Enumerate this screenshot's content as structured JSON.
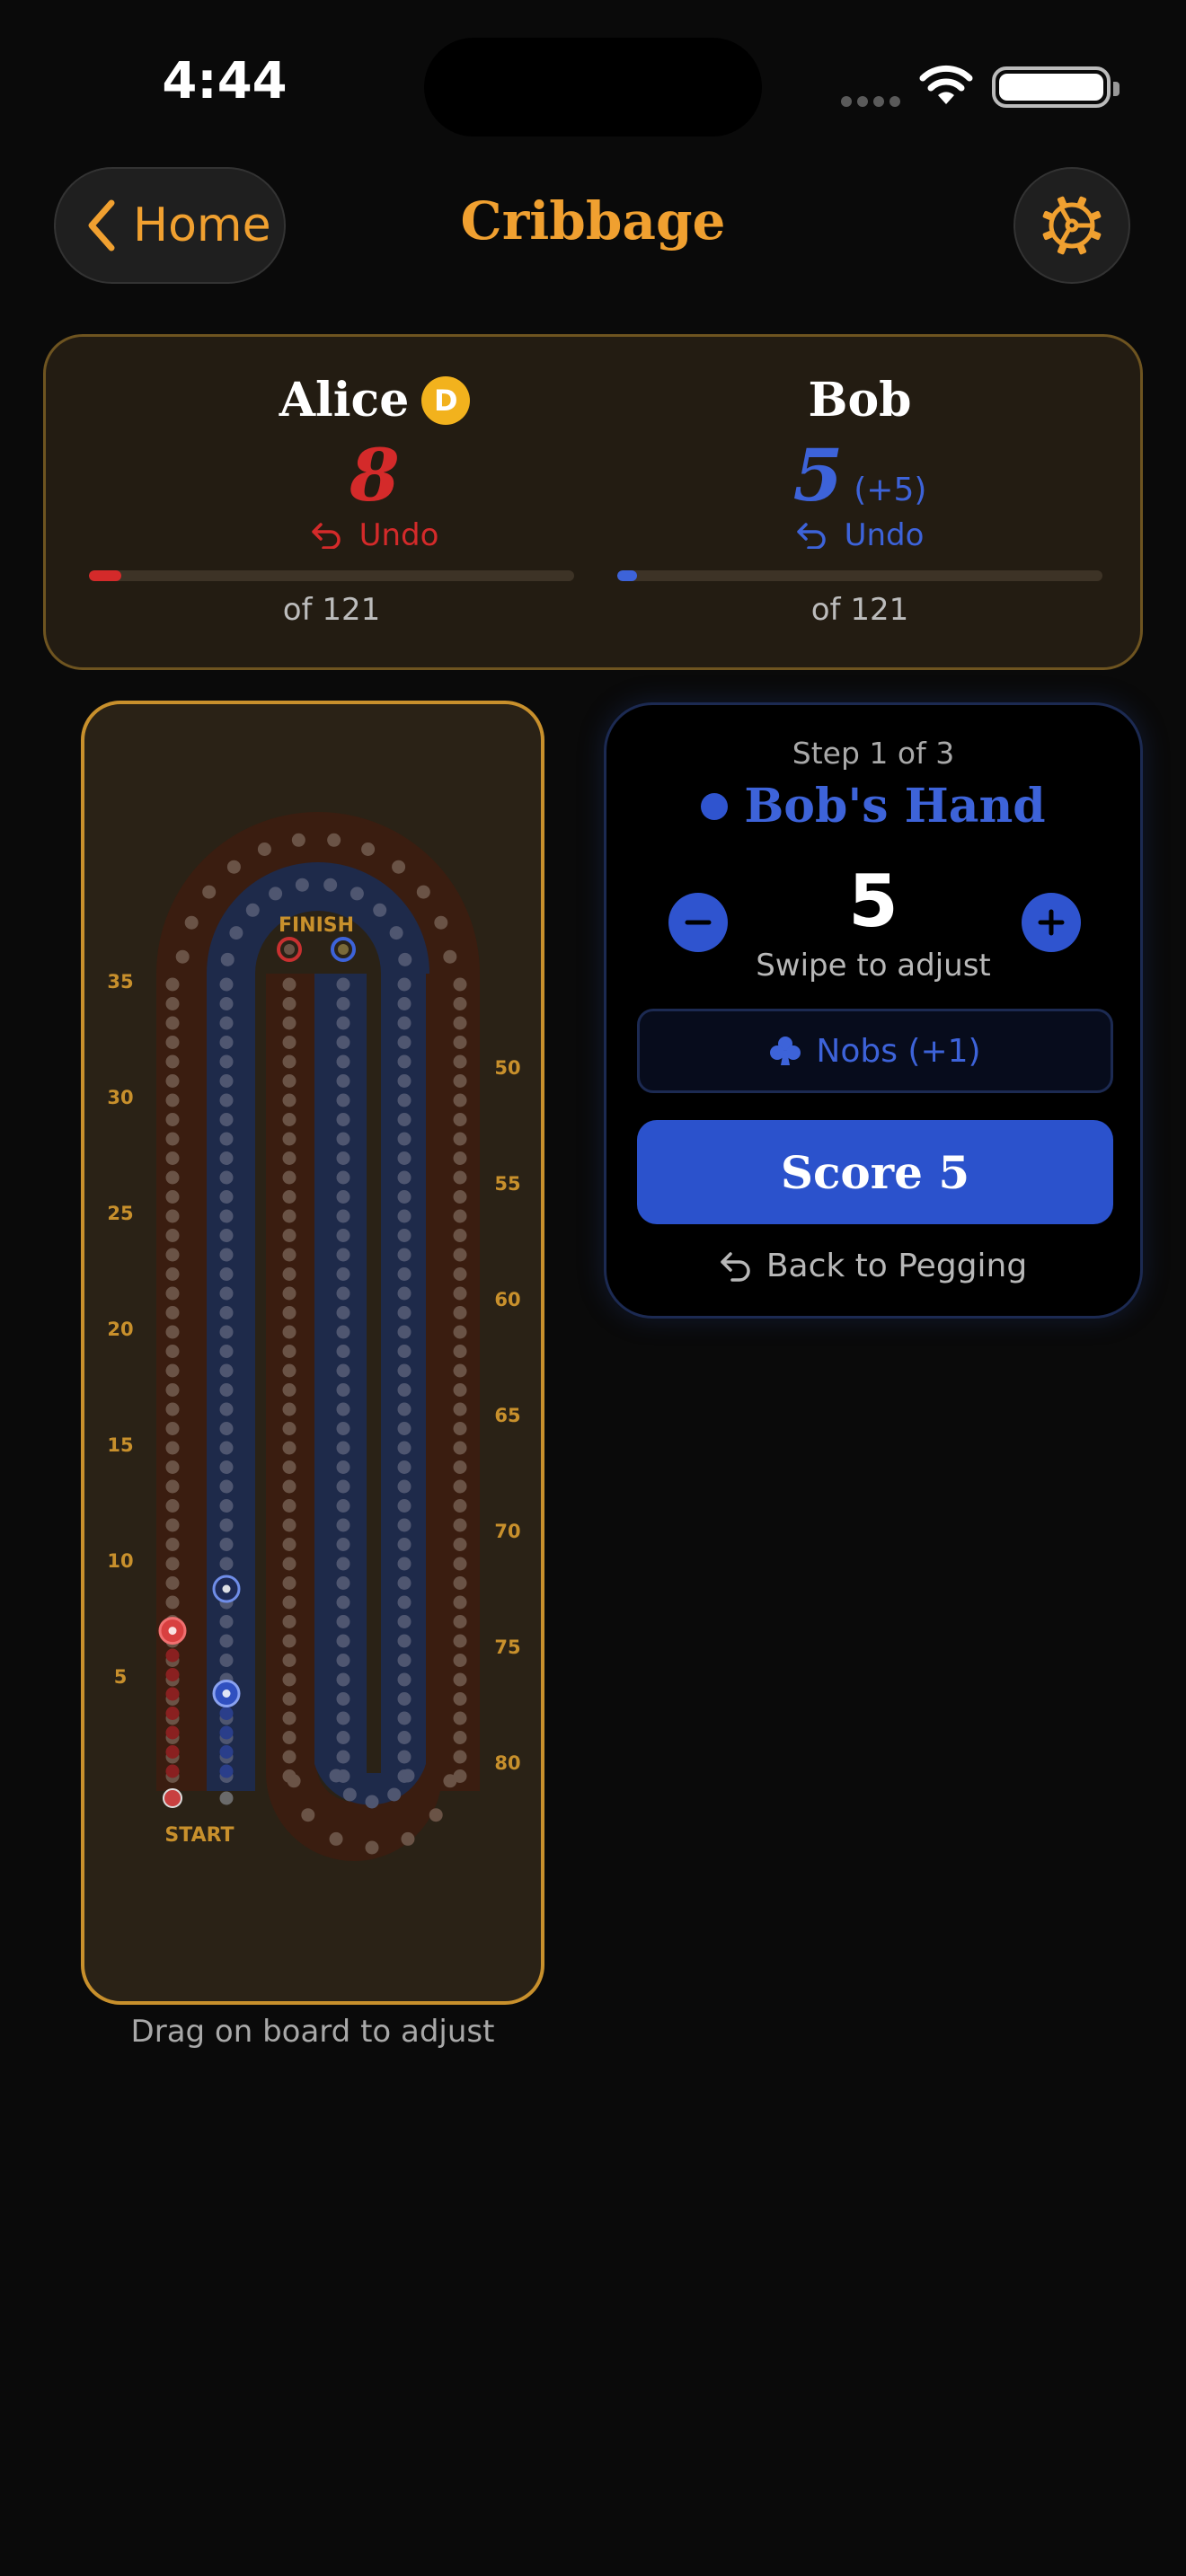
{
  "status_bar": {
    "time": "4:44"
  },
  "nav": {
    "home_label": "Home",
    "title": "Cribbage"
  },
  "players": [
    {
      "name": "Alice",
      "dealer_badge": "D",
      "score": "8",
      "pending": "",
      "undo_label": "Undo",
      "of_total": "of 121",
      "progress": 0.066,
      "color": "#d42a2a"
    },
    {
      "name": "Bob",
      "dealer_badge": "",
      "score": "5",
      "pending": "(+5)",
      "undo_label": "Undo",
      "of_total": "of 121",
      "progress": 0.041,
      "color": "#3d63d9"
    }
  ],
  "board": {
    "finish_label": "FINISH",
    "start_label": "START",
    "left_ticks": [
      "35",
      "30",
      "25",
      "20",
      "15",
      "10",
      "5"
    ],
    "right_ticks": [
      "50",
      "55",
      "60",
      "65",
      "70",
      "75",
      "80"
    ],
    "caption": "Drag on board to adjust",
    "pegs": {
      "alice_front": 8,
      "bob_front": 10,
      "bob_back": 5
    },
    "colors": {
      "red_track": "#3a1d10",
      "blue_track": "#1e2a4a",
      "accent": "#c8902c"
    }
  },
  "step_panel": {
    "step_label": "Step 1 of 3",
    "title": "Bob's Hand",
    "value": "5",
    "swipe_hint": "Swipe to adjust",
    "nobs_label": "Nobs (+1)",
    "score_label": "Score 5",
    "back_label": "Back to Pegging"
  },
  "icons": {
    "back": "chevron-left-icon",
    "settings": "gear-icon",
    "undo": "undo-arrow-icon",
    "minus": "minus-icon",
    "plus": "plus-icon",
    "club": "club-icon"
  }
}
